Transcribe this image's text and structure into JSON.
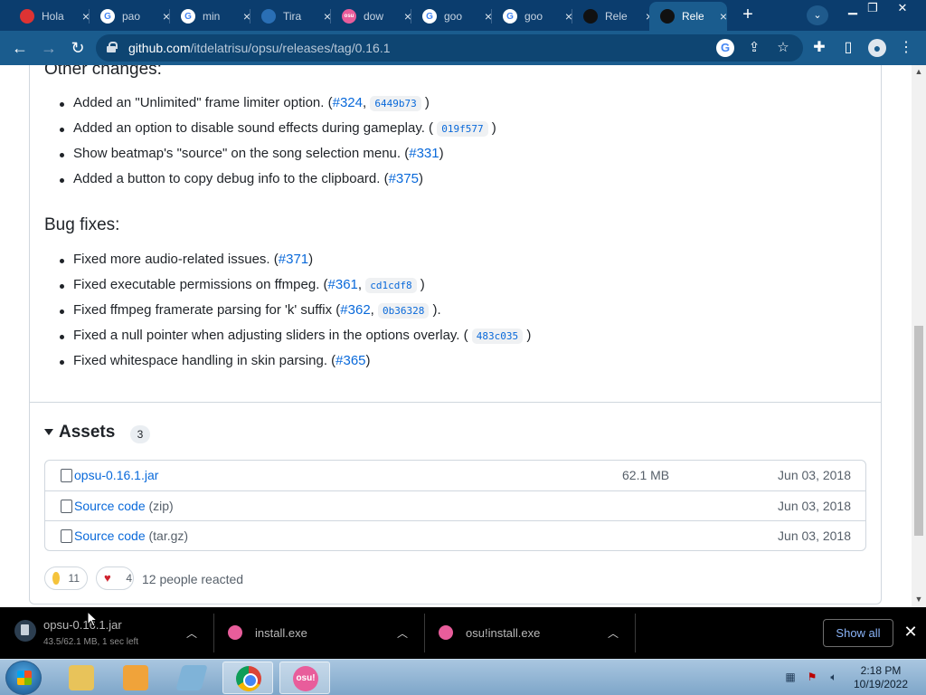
{
  "browser": {
    "tabs": [
      {
        "title": "Hola",
        "favicon": "magazine-icon"
      },
      {
        "title": "pao",
        "favicon": "google-icon"
      },
      {
        "title": "min",
        "favicon": "google-icon"
      },
      {
        "title": "Tira",
        "favicon": "wikipedia-icon"
      },
      {
        "title": "dow",
        "favicon": "osu-icon"
      },
      {
        "title": "goo",
        "favicon": "google-icon"
      },
      {
        "title": "goo",
        "favicon": "google-icon"
      },
      {
        "title": "Rele",
        "favicon": "github-icon"
      },
      {
        "title": "Rele",
        "favicon": "github-icon"
      }
    ],
    "url_host": "github.com",
    "url_path": "/itdelatrisu/opsu/releases/tag/0.16.1"
  },
  "release": {
    "other_changes_title": "Other changes:",
    "other_changes": [
      {
        "pre": "Added an \"Unlimited\" frame limiter option. (",
        "link": "#324",
        "mid": ", ",
        "code": "6449b73",
        "post": " )"
      },
      {
        "pre": "Added an option to disable sound effects during gameplay. ( ",
        "link": "",
        "mid": "",
        "code": "019f577",
        "post": " )"
      },
      {
        "pre": "Show beatmap's \"source\" on the song selection menu. (",
        "link": "#331",
        "mid": "",
        "code": "",
        "post": ")"
      },
      {
        "pre": "Added a button to copy debug info to the clipboard. (",
        "link": "#375",
        "mid": "",
        "code": "",
        "post": ")"
      }
    ],
    "bug_fixes_title": "Bug fixes:",
    "bug_fixes": [
      {
        "pre": "Fixed more audio-related issues. (",
        "link": "#371",
        "mid": "",
        "code": "",
        "post": ")"
      },
      {
        "pre": "Fixed executable permissions on ffmpeg. (",
        "link": "#361",
        "mid": ", ",
        "code": "cd1cdf8",
        "post": " )"
      },
      {
        "pre": "Fixed ffmpeg framerate parsing for 'k' suffix (",
        "link": "#362",
        "mid": ", ",
        "code": "0b36328",
        "post": " )."
      },
      {
        "pre": "Fixed a null pointer when adjusting sliders in the options overlay. ( ",
        "link": "",
        "mid": "",
        "code": "483c035",
        "post": " )"
      },
      {
        "pre": "Fixed whitespace handling in skin parsing. (",
        "link": "#365",
        "mid": "",
        "code": "",
        "post": ")"
      }
    ]
  },
  "assets": {
    "title": "Assets",
    "count": "3",
    "rows": [
      {
        "name": "opsu-0.16.1.jar",
        "ext": "",
        "size": "62.1 MB",
        "date": "Jun 03, 2018"
      },
      {
        "name": "Source code",
        "ext": " (zip)",
        "size": "",
        "date": "Jun 03, 2018"
      },
      {
        "name": "Source code",
        "ext": " (tar.gz)",
        "size": "",
        "date": "Jun 03, 2018"
      }
    ]
  },
  "reactions": {
    "smile_count": "11",
    "heart_count": "4",
    "summary": "12 people reacted"
  },
  "downloads": {
    "items": [
      {
        "name": "opsu-0.16.1.jar",
        "status": "43.5/62.1 MB, 1 sec left"
      },
      {
        "name": "install.exe",
        "status": ""
      },
      {
        "name": "osu!install.exe",
        "status": ""
      }
    ],
    "show_all": "Show all"
  },
  "taskbar": {
    "osu_label": "osu!",
    "time": "2:18 PM",
    "date": "10/19/2022"
  }
}
